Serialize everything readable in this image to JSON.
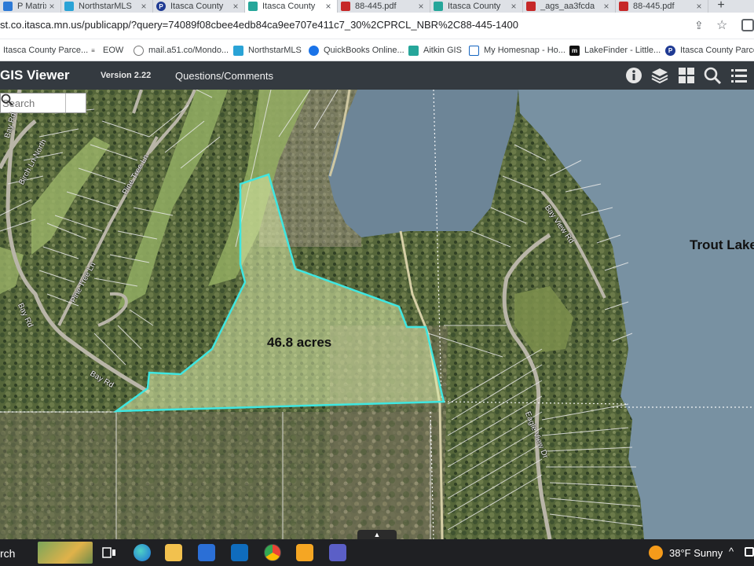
{
  "browser": {
    "tabs": [
      {
        "label": "P Matrix",
        "icon": "matrix-icon",
        "color": "#2d7ad6"
      },
      {
        "label": "NorthstarMLS",
        "icon": "northstar-icon",
        "color": "#2aa3d6"
      },
      {
        "label": "Itasca County",
        "icon": "parcel-icon",
        "color": "#1f3a93"
      },
      {
        "label": "Itasca County",
        "icon": "gis-icon",
        "color": "#26a69a"
      },
      {
        "label": "88-445.pdf",
        "icon": "pdf-icon",
        "color": "#c62828"
      },
      {
        "label": "Itasca County",
        "icon": "gis-icon",
        "color": "#26a69a"
      },
      {
        "label": "_ags_aa3fcda",
        "icon": "pdf-icon",
        "color": "#c62828"
      },
      {
        "label": "88-445.pdf",
        "icon": "pdf-icon",
        "color": "#c62828"
      }
    ],
    "new_tab": "+",
    "url": "st.co.itasca.mn.us/publicapp/?query=74089f08cbee4edb84ca9ee707e411c7_30%2CPRCL_NBR%2C88-445-1400",
    "bookmarks": [
      {
        "label": "Itasca County Parce...",
        "icon": "globe-icon"
      },
      {
        "label": "EOW",
        "icon": "eow-icon"
      },
      {
        "label": "mail.a51.co/Mondo...",
        "icon": "blocked-icon"
      },
      {
        "label": "NorthstarMLS",
        "icon": "northstar-icon"
      },
      {
        "label": "QuickBooks Online...",
        "icon": "quickbooks-icon"
      },
      {
        "label": "Aitkin GIS",
        "icon": "gis-icon"
      },
      {
        "label": "My Homesnap - Ho...",
        "icon": "homesnap-icon"
      },
      {
        "label": "LakeFinder - Little...",
        "icon": "lakefinder-icon"
      },
      {
        "label": "Itasca County Parce...",
        "icon": "parcel-icon"
      }
    ]
  },
  "app": {
    "title": "GIS Viewer",
    "version": "Version 2.22",
    "questions_link": "Questions/Comments",
    "header_icons": [
      "info-icon",
      "layers-icon",
      "basemap-grid-icon",
      "search-icon",
      "menu-list-icon"
    ]
  },
  "map": {
    "search_placeholder": "Search",
    "parcel_label": "46.8 acres",
    "lake_label": "Trout Lake",
    "parcel_color": "#3fe6e0",
    "roads": [
      "Bay Rd",
      "Birch Ln North",
      "Pine Tree Ln",
      "Pine Tree Ln",
      "Bay Rd",
      "Bay Rd",
      "Bay View Rd",
      "Eagle View Dr"
    ],
    "toggle_symbol": "▲"
  },
  "taskbar": {
    "search_text": "rch",
    "apps": [
      "task-view-icon",
      "edge-icon",
      "file-explorer-icon",
      "store-icon",
      "outlook-icon",
      "chrome-icon",
      "video-icon",
      "teams-icon"
    ],
    "weather": "38°F  Sunny",
    "tray_chevron": "^"
  }
}
